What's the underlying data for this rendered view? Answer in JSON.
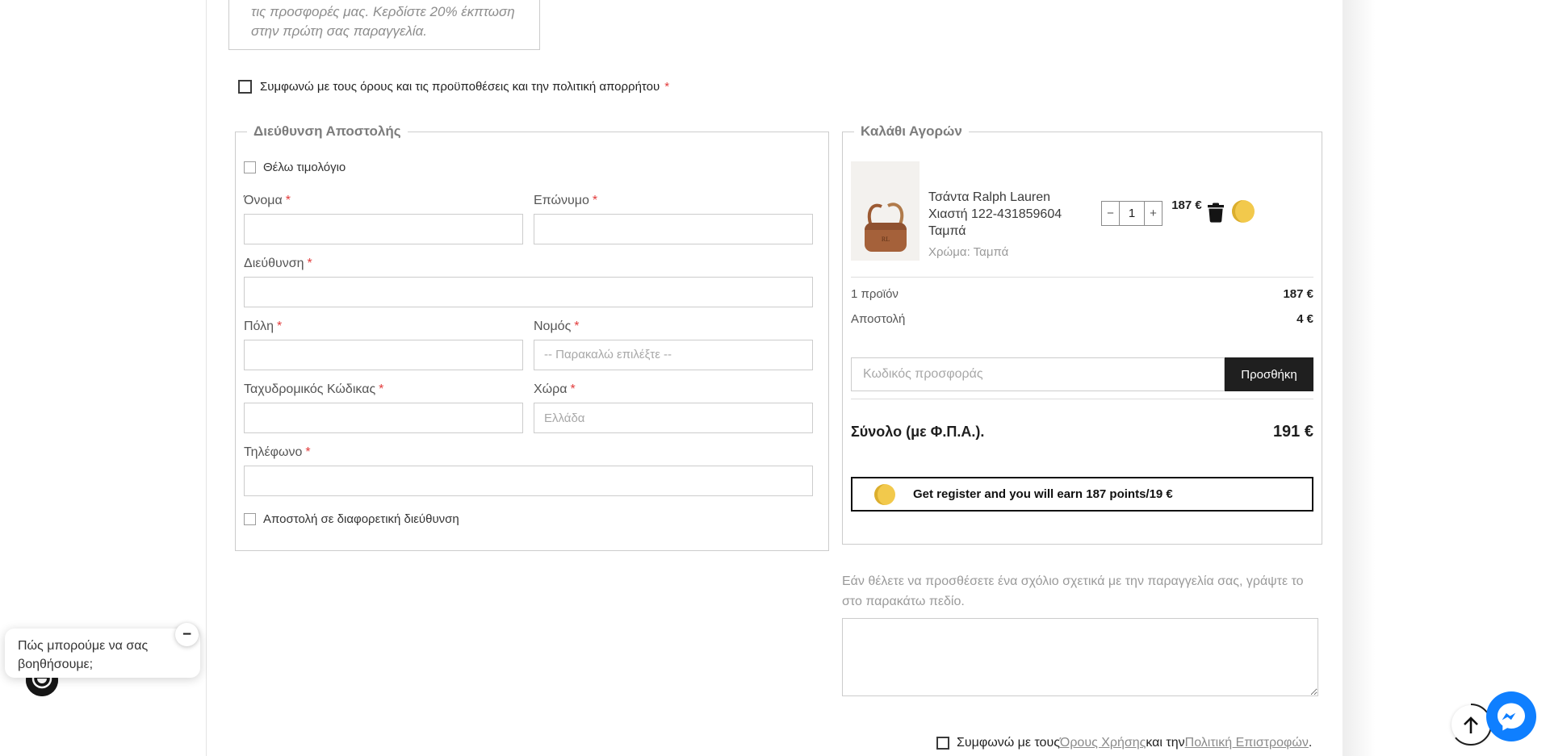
{
  "newsletter_box": {
    "line1": "τις προσφορές μας. Κερδίστε 20% έκπτωση",
    "line2": "στην πρώτη σας παραγγελία."
  },
  "required_mark": "*",
  "terms_top": {
    "label": "Συμφωνώ με τους όρους και τις προϋποθέσεις και την πολιτική απορρήτου"
  },
  "shipping": {
    "legend": "Διεύθυνση Αποστολής",
    "invoice_checkbox_label": "Θέλω τιμολόγιο",
    "fields": {
      "first_name": {
        "label": "Όνομα",
        "value": ""
      },
      "last_name": {
        "label": "Επώνυμο",
        "value": ""
      },
      "address": {
        "label": "Διεύθυνση",
        "value": ""
      },
      "city": {
        "label": "Πόλη",
        "value": ""
      },
      "region": {
        "label": "Νομός",
        "selected_option": "-- Παρακαλώ επιλέξτε --"
      },
      "postal_code": {
        "label": "Ταχυδρομικός Κώδικας",
        "value": ""
      },
      "country": {
        "label": "Χώρα",
        "placeholder": "Ελλάδα",
        "value": ""
      },
      "phone": {
        "label": "Τηλέφωνο",
        "value": ""
      }
    },
    "different_address_checkbox_label": "Αποστολή σε διαφορετική διεύθυνση"
  },
  "cart": {
    "legend": "Καλάθι Αγορών",
    "item": {
      "title": "Τσάντα Ralph Lauren Χιαστή 122-431859604 Ταμπά",
      "color": "Χρώμα: Ταμπά",
      "qty": "1",
      "minus": "−",
      "plus": "+",
      "price": "187 €"
    },
    "summary": [
      {
        "label": "1 προϊόν",
        "value": "187 €"
      },
      {
        "label": "Αποστολή",
        "value": "4 €"
      }
    ],
    "promo": {
      "placeholder": "Κωδικός προσφοράς",
      "button": "Προσθήκη"
    },
    "total": {
      "label": "Σύνολο (με Φ.Π.Α.).",
      "value": "191 €"
    },
    "points_banner": "Get register and you will earn 187 points/19 €"
  },
  "comment": {
    "note": "Εάν θέλετε να προσθέσετε ένα σχόλιο σχετικά με την παραγγελία σας, γράψτε το στο παρακάτω πεδίο.",
    "value": ""
  },
  "terms_bottom": {
    "prefix": "Συμφωνώ με τους ",
    "link_terms": "Όρους Χρήσης",
    "middle": " και την ",
    "link_returns": "Πολιτική Επιστροφών",
    "suffix": "."
  },
  "chat": {
    "message": "Πώς μπορούμε να σας βοηθήσουμε;",
    "minimize": "−"
  },
  "colors": {
    "button_dark": "#1f1f1f",
    "coin_yellow": "#f2c94c",
    "messenger_blue": "#0f7fff",
    "asterisk_red": "#e23b3b",
    "link_gray": "#8a8a8a"
  }
}
